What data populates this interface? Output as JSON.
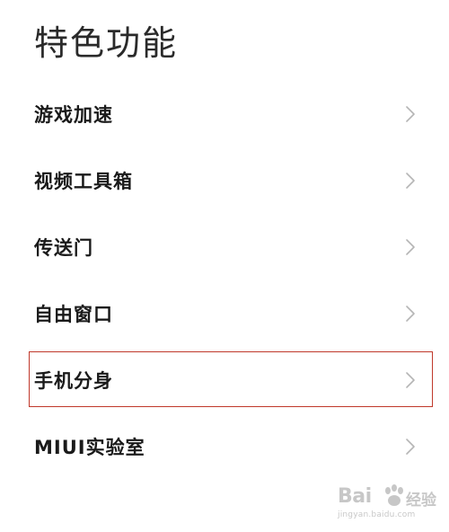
{
  "header": {
    "title": "特色功能"
  },
  "menu": {
    "items": [
      {
        "label": "游戏加速",
        "highlighted": false
      },
      {
        "label": "视频工具箱",
        "highlighted": false
      },
      {
        "label": "传送门",
        "highlighted": false
      },
      {
        "label": "自由窗口",
        "highlighted": false
      },
      {
        "label": "手机分身",
        "highlighted": true
      },
      {
        "label": "MIUI实验室",
        "highlighted": false
      }
    ],
    "chevron_icon": "chevron-right-icon"
  },
  "colors": {
    "text": "#1a1a1a",
    "chevron": "#b5b5b5",
    "highlight_border": "#c0392b",
    "background": "#ffffff"
  },
  "watermark": {
    "brand": "Bai",
    "suffix": "经验",
    "url": "jingyan.baidu.com"
  }
}
